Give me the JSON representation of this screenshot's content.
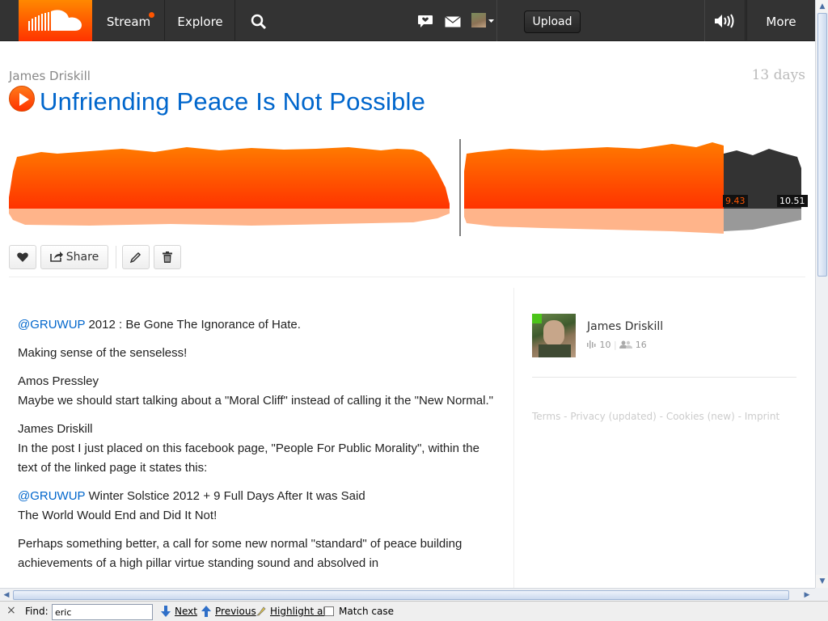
{
  "nav": {
    "stream": "Stream",
    "explore": "Explore",
    "upload": "Upload",
    "more": "More"
  },
  "track": {
    "author": "James Driskill",
    "age": "13 days",
    "title": "Unfriending Peace Is Not Possible",
    "current_time": "9.43",
    "total_time": "10.51",
    "progress": 0.898
  },
  "actions": {
    "share": "Share"
  },
  "description": {
    "p1_mention": "@GRUWUP",
    "p1_text": " 2012 : Be Gone The Ignorance of Hate.",
    "p2": "Making sense of the senseless!",
    "p3_name": "Amos Pressley",
    "p3_text": "Maybe we should start talking about a \"Moral Cliff\" instead of calling it the \"New Normal.\"",
    "p4_name": "James Driskill",
    "p4_text": "In the post I just placed on this facebook page, \"People For Public Morality\", within the text of the linked page it states this:",
    "p5_mention": "@GRUWUP",
    "p5_text": " Winter Solstice 2012 + 9 Full Days After It was Said",
    "p5_text2": "The World Would End and Did It Not!",
    "p6": "Perhaps something better, a call for some new normal \"standard\" of peace building achievements of a high pillar virtue standing sound and absolved in"
  },
  "sidebar": {
    "user_name": "James Driskill",
    "tracks_count": "10",
    "followers_count": "16",
    "footer": {
      "terms": "Terms",
      "sep": " - ",
      "privacy": "Privacy (updated)",
      "cookies": "Cookies (new)",
      "imprint": "Imprint"
    }
  },
  "findbar": {
    "label": "Find:",
    "query": "eric",
    "next": "Next",
    "previous": "Previous",
    "highlight": "Highlight all",
    "match_case": "Match case"
  },
  "colors": {
    "accent": "#ff3300",
    "link": "#0066cc",
    "nav_bg": "#333333"
  }
}
